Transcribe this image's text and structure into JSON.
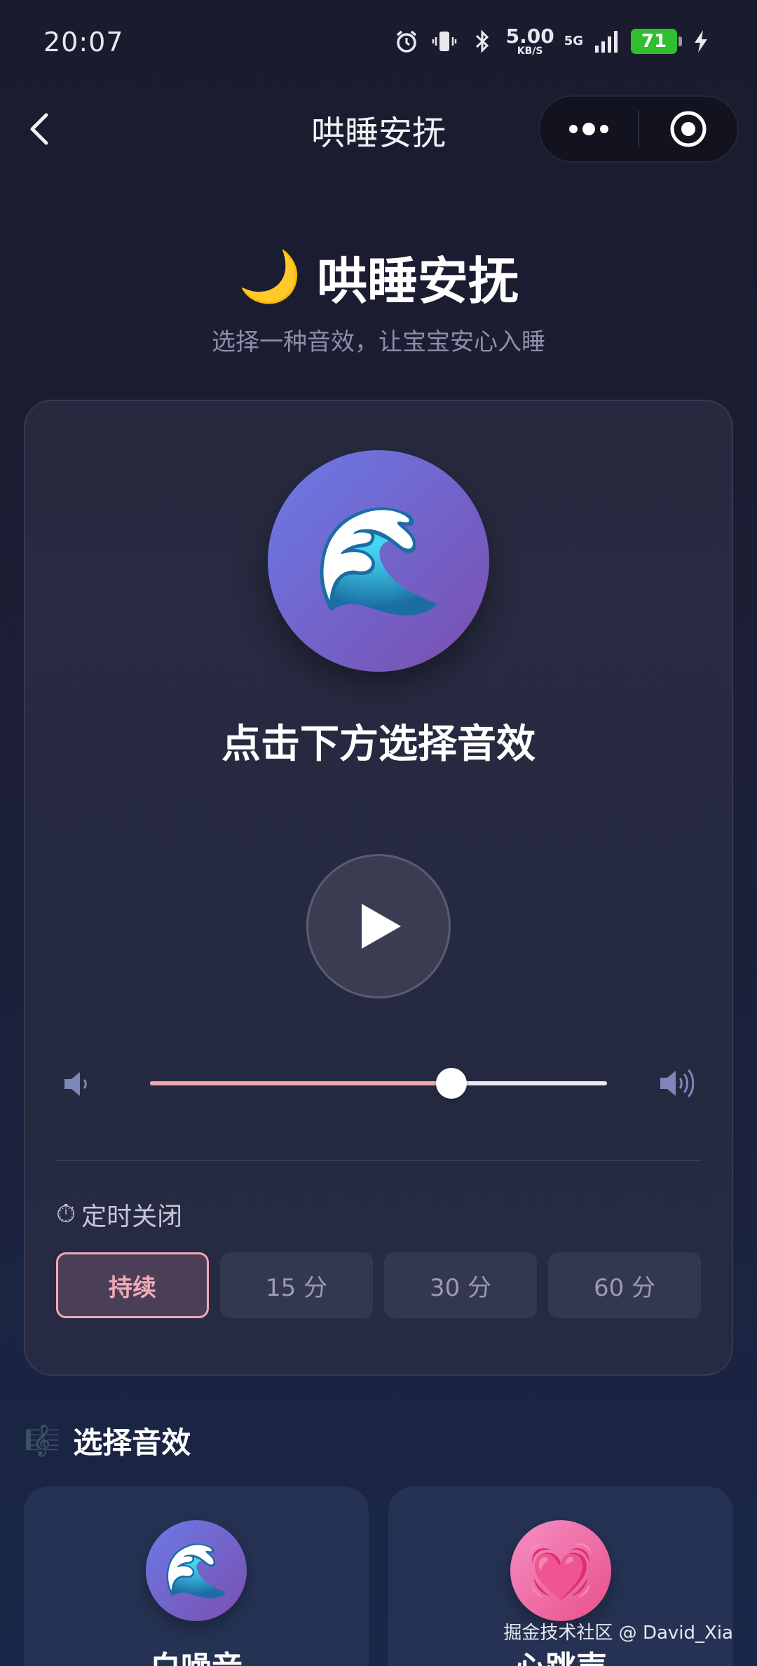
{
  "status_bar": {
    "time": "20:07",
    "speed_value": "5.00",
    "speed_unit": "KB/S",
    "network": "5G",
    "battery": "71"
  },
  "nav": {
    "title": "哄睡安抚"
  },
  "header": {
    "emoji": "🌙",
    "title": "哄睡安抚",
    "subtitle": "选择一种音效，让宝宝安心入睡"
  },
  "player": {
    "current_emoji": "🌊",
    "prompt": "点击下方选择音效",
    "volume_fraction": 0.66
  },
  "timer": {
    "icon": "⏱",
    "label": "定时关闭",
    "options": [
      "持续",
      "15 分",
      "30 分",
      "60 分"
    ],
    "selected_index": 0
  },
  "sounds_section": {
    "icon": "🎼",
    "title": "选择音效",
    "items": [
      {
        "emoji": "🌊",
        "name": "白噪音"
      },
      {
        "emoji": "💓",
        "name": "心跳声"
      }
    ]
  },
  "watermark": "掘金技术社区 @ David_Xia",
  "colors": {
    "accent_pink": "#f0a8b4",
    "card_bg": "#272a3f",
    "battery_green": "#2fbf2f"
  }
}
